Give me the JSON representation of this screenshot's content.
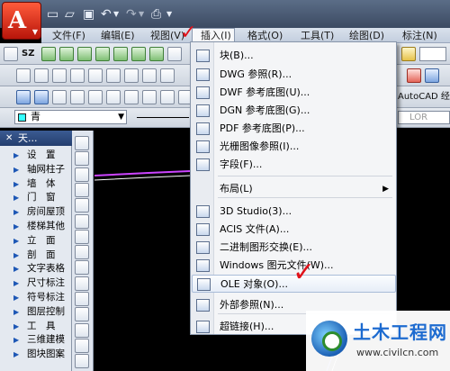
{
  "menubar": {
    "items": [
      "文件(F)",
      "编辑(E)",
      "视图(V)",
      "插入(I)",
      "格式(O)",
      "工具(T)",
      "绘图(D)",
      "标注(N)"
    ]
  },
  "toolbar": {
    "sz_label": "SZ",
    "autocad_text": "AutoCAD 经",
    "bylayer_text": "LOR",
    "layer_value": "青"
  },
  "palette": {
    "title": "天...",
    "items": [
      "设　置",
      "轴网柱子",
      "墙　体",
      "门　窗",
      "房间屋顶",
      "楼梯其他",
      "立　面",
      "剖　面",
      "文字表格",
      "尺寸标注",
      "符号标注",
      "图层控制",
      "工　具",
      "三维建模",
      "图块图案"
    ]
  },
  "insert_menu": {
    "items": [
      {
        "label": "块(B)...",
        "icon": "block-icon",
        "submenu": false
      },
      {
        "label": "DWG 参照(R)...",
        "icon": "dwg-reference-icon",
        "submenu": false
      },
      {
        "label": "DWF 参考底图(U)...",
        "icon": "dwf-underlay-icon",
        "submenu": false
      },
      {
        "label": "DGN 参考底图(G)...",
        "icon": "dgn-underlay-icon",
        "submenu": false
      },
      {
        "label": "PDF 参考底图(P)...",
        "icon": "pdf-underlay-icon",
        "submenu": false
      },
      {
        "label": "光栅图像参照(I)...",
        "icon": "raster-image-icon",
        "submenu": false
      },
      {
        "label": "字段(F)...",
        "icon": "field-icon",
        "submenu": false
      },
      {
        "label": "布局(L)",
        "icon": "",
        "submenu": true
      },
      {
        "label": "3D Studio(3)...",
        "icon": "3d-studio-icon",
        "submenu": false
      },
      {
        "label": "ACIS 文件(A)...",
        "icon": "acis-file-icon",
        "submenu": false
      },
      {
        "label": "二进制图形交换(E)...",
        "icon": "binary-dxf-icon",
        "submenu": false
      },
      {
        "label": "Windows 图元文件(W)...",
        "icon": "windows-metafile-icon",
        "submenu": false
      },
      {
        "label": "OLE 对象(O)...",
        "icon": "ole-object-icon",
        "submenu": false
      },
      {
        "label": "外部参照(N)...",
        "icon": "external-reference-icon",
        "submenu": false
      },
      {
        "label": "超链接(H)...",
        "icon": "hyperlink-icon",
        "submenu": false
      }
    ],
    "highlighted": "OLE 对象(O)..."
  },
  "annotations": {
    "check_color": "#e0121a"
  },
  "watermark": {
    "title": "土木工程网",
    "url": "www.civilcn.com"
  }
}
